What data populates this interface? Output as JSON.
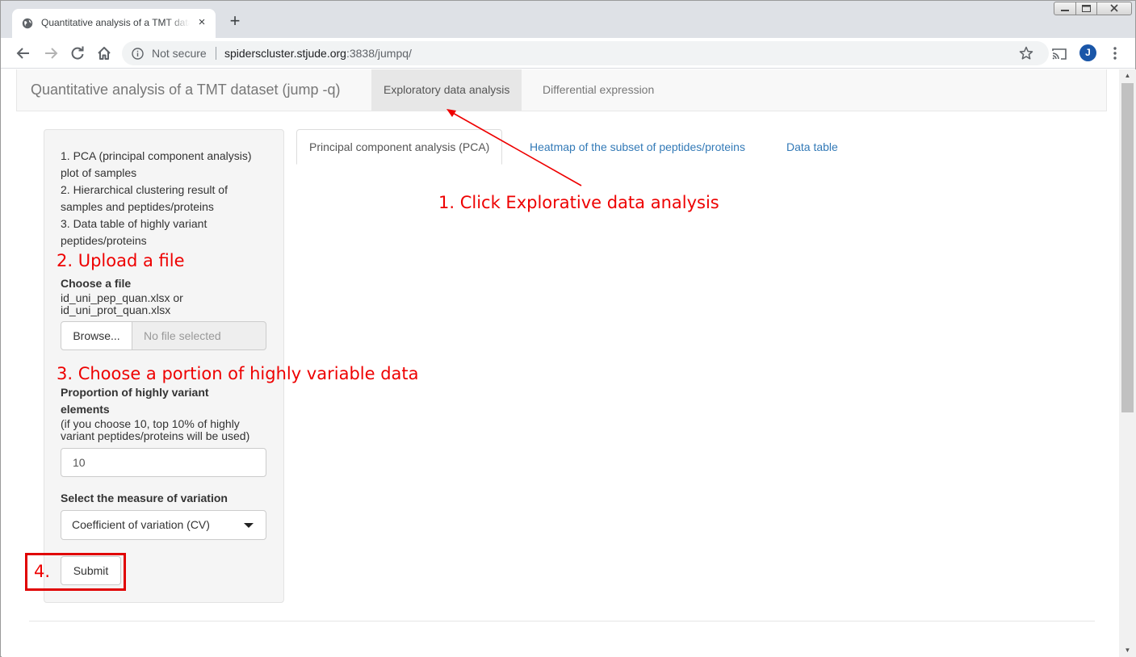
{
  "browser": {
    "tab_title": "Quantitative analysis of a TMT dataset (jump -q)",
    "tab_close_glyph": "×",
    "new_tab_glyph": "+",
    "security_label": "Not secure",
    "url_host": "spiderscluster.stjude.org",
    "url_rest": ":3838/jumpq/",
    "avatar_letter": "J",
    "icons": [
      "globe-icon",
      "close-icon",
      "plus-icon",
      "back-icon",
      "forward-icon",
      "reload-icon",
      "home-icon",
      "info-icon",
      "star-icon",
      "cast-icon",
      "menu-icon",
      "minimize-icon",
      "maximize-icon",
      "window-close-icon"
    ]
  },
  "navbar": {
    "brand": "Quantitative analysis of a TMT dataset (jump -q)",
    "items": [
      {
        "label": "Exploratory data analysis",
        "active": true
      },
      {
        "label": "Differential expression",
        "active": false
      }
    ]
  },
  "sidebar": {
    "description": [
      "1. PCA (principal component analysis)",
      "plot of samples",
      "2. Hierarchical clustering result of",
      "samples and peptides/proteins",
      "3. Data table of highly variant",
      "peptides/proteins"
    ],
    "file_label": "Choose a file",
    "file_hint_1": "id_uni_pep_quan.xlsx or",
    "file_hint_2": "id_uni_prot_quan.xlsx",
    "browse_label": "Browse...",
    "file_placeholder": "No file selected",
    "proportion_label_1": "Proportion of highly variant",
    "proportion_label_2": "elements",
    "proportion_hint_1": "(if you choose 10, top 10% of highly",
    "proportion_hint_2": "variant peptides/proteins will be used)",
    "proportion_value": "10",
    "measure_label": "Select the measure of variation",
    "measure_value": "Coefficient of variation (CV)",
    "submit_label": "Submit"
  },
  "tabs": [
    {
      "label": "Principal component analysis (PCA)",
      "active": true
    },
    {
      "label": "Heatmap of the subset of peptides/proteins",
      "active": false
    },
    {
      "label": "Data table",
      "active": false
    }
  ],
  "annotations": {
    "step1": "1. Click Explorative data analysis",
    "step2": "2. Upload a file",
    "step3": "3. Choose a portion of highly variable data",
    "step4": "4.",
    "color": "#ee0000"
  },
  "colors": {
    "link": "#337ab7",
    "navbar_bg": "#f8f8f8",
    "active_nav": "#e7e7e7",
    "well_bg": "#f5f5f5",
    "annotation": "#ee0000"
  }
}
